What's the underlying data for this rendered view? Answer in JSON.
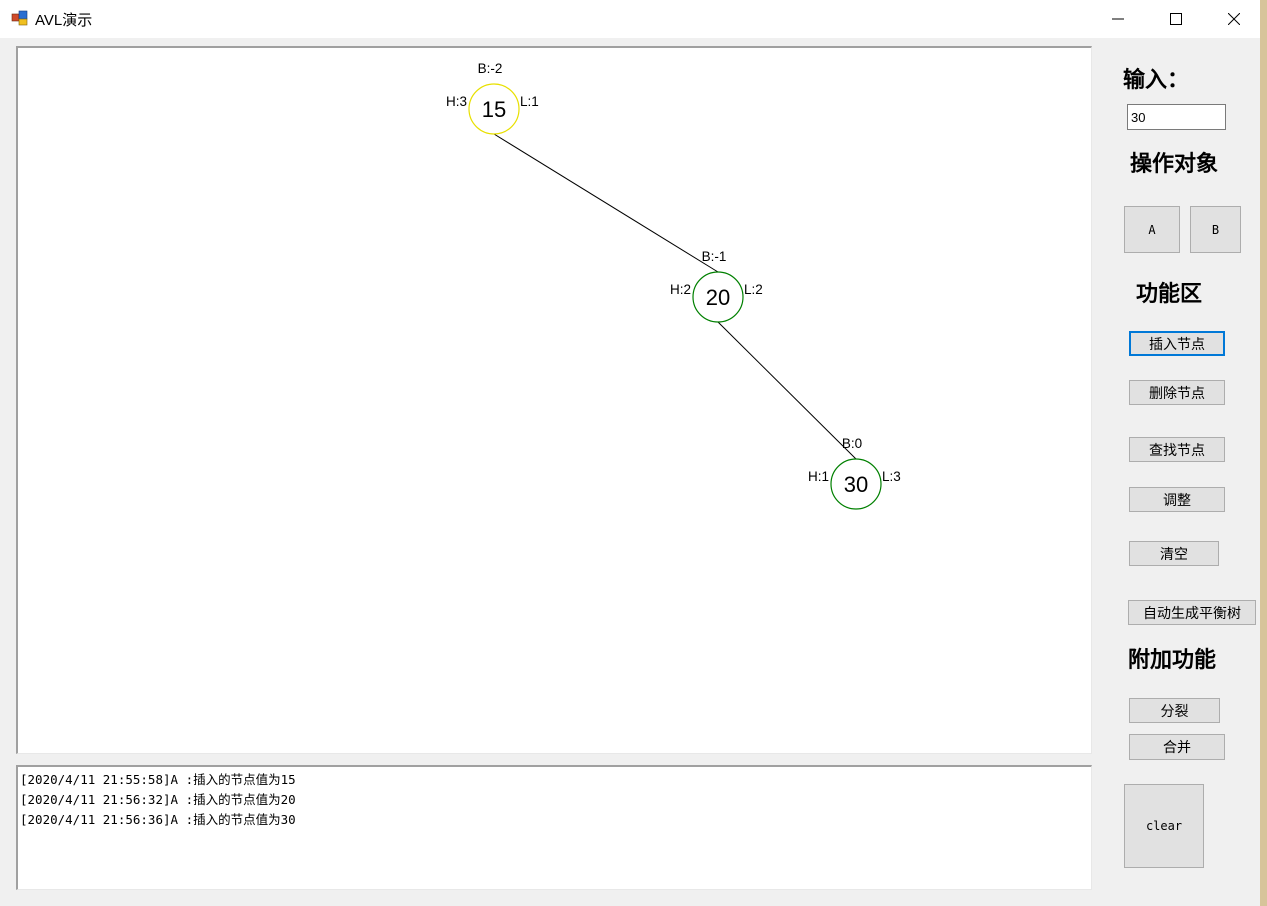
{
  "window": {
    "title": "AVL演示",
    "controls": {
      "minimize": "minimize-icon",
      "maximize": "maximize-icon",
      "close": "close-icon"
    }
  },
  "sidebar": {
    "input_heading": "输入：",
    "input_value": "30",
    "target_heading": "操作对象",
    "target_buttons": {
      "a": "A",
      "b": "B"
    },
    "function_heading": "功能区",
    "function_buttons": {
      "insert": "插入节点",
      "delete": "删除节点",
      "find": "查找节点",
      "adjust": "调整",
      "clear_tree": "清空",
      "auto_balance": "自动生成平衡树"
    },
    "extra_heading": "附加功能",
    "extra_buttons": {
      "split": "分裂",
      "merge": "合并"
    },
    "clear_log": "clear"
  },
  "tree": {
    "nodes": [
      {
        "value": "15",
        "balance": "B:-2",
        "height": "H:3",
        "level": "L:1",
        "status": "unbalanced",
        "color": "#e8e000"
      },
      {
        "value": "20",
        "balance": "B:-1",
        "height": "H:2",
        "level": "L:2",
        "status": "normal",
        "color": "#008000"
      },
      {
        "value": "30",
        "balance": "B:0",
        "height": "H:1",
        "level": "L:3",
        "status": "normal",
        "color": "#008000"
      }
    ],
    "edges": [
      [
        0,
        1
      ],
      [
        1,
        2
      ]
    ]
  },
  "log": [
    "[2020/4/11 21:55:58]A :插入的节点值为15",
    "[2020/4/11 21:56:32]A :插入的节点值为20",
    "[2020/4/11 21:56:36]A :插入的节点值为30"
  ]
}
